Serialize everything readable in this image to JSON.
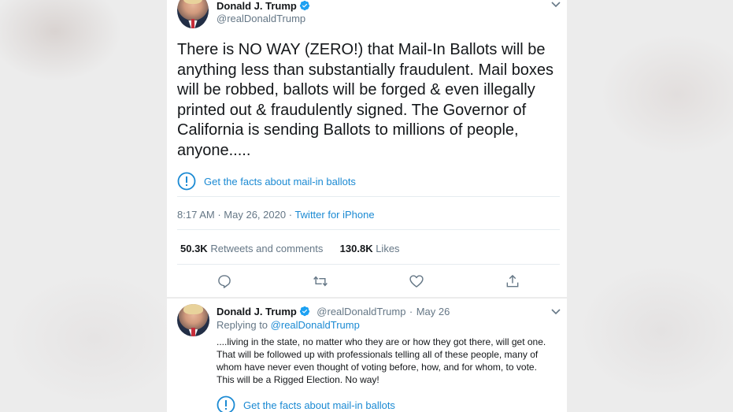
{
  "tweet": {
    "author_name": "Donald J. Trump",
    "author_handle": "@realDonaldTrump",
    "text": "There is NO WAY (ZERO!) that Mail-In Ballots will be anything less than substantially fraudulent. Mail boxes will be robbed, ballots will be forged & even illegally printed out & fraudulently signed. The Governor of California is sending Ballots to millions of people, anyone.....",
    "facts_link": "Get the facts about mail-in ballots",
    "time": "8:17 AM",
    "date": "May 26, 2020",
    "separator": "·",
    "source": "Twitter for iPhone",
    "retweets_count": "50.3K",
    "retweets_label": "Retweets and comments",
    "likes_count": "130.8K",
    "likes_label": "Likes",
    "actions": [
      "reply-icon",
      "retweet-icon",
      "like-icon",
      "share-icon"
    ]
  },
  "reply": {
    "author_name": "Donald J. Trump",
    "author_handle": "@realDonaldTrump",
    "separator": "·",
    "date": "May 26",
    "replying_to_label": "Replying to",
    "replying_to_handle": "@realDonaldTrump",
    "text": "....living in the state, no matter who they are or how they got there, will get one. That will be followed up with professionals telling all of these people, many of whom have never even thought of voting before, how, and for whom, to vote. This will be a Rigged Election. No way!",
    "facts_link": "Get the facts about mail-in ballots"
  },
  "colors": {
    "link_blue": "#1b8ad3",
    "verified_blue": "#1da1f2",
    "muted_gray": "#657786",
    "text_dark": "#14171a"
  }
}
